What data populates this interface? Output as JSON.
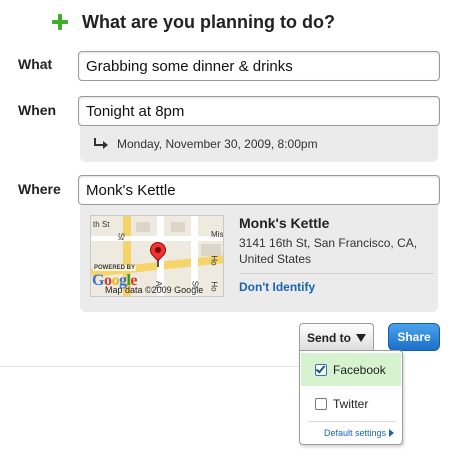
{
  "header": {
    "title": "What are you planning to do?"
  },
  "what": {
    "label": "What",
    "value": "Grabbing some dinner & drinks"
  },
  "when": {
    "label": "When",
    "value": "Tonight at 8pm",
    "parsed": "Monday, November 30, 2009, 8:00pm"
  },
  "where": {
    "label": "Where",
    "value": "Monk's Kettle",
    "place_name": "Monk's Kettle",
    "address_line1": "3141 16th St, San Francisco, CA,",
    "address_line2": "United States",
    "dont_identify": "Don't Identify",
    "map": {
      "powered_by": "POWERED BY",
      "credit": "Map data ©2009 Google",
      "street_labels": [
        "th St",
        "St",
        "Mis",
        "Ho",
        "Ho",
        "St",
        "Al"
      ]
    }
  },
  "send": {
    "button_label": "Send to",
    "share_label": "Share",
    "options": [
      {
        "label": "Facebook",
        "checked": true
      },
      {
        "label": "Twitter",
        "checked": false
      }
    ],
    "default_settings": "Default settings"
  },
  "colors": {
    "accent": "#1a64b5",
    "plus": "#3fae2a",
    "selected_bg": "#d6f2cf",
    "share": "#1b6fc8"
  }
}
